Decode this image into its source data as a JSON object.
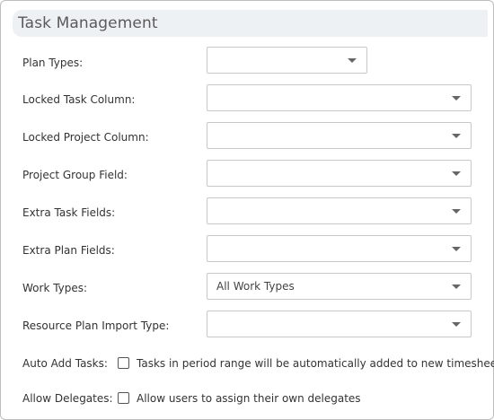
{
  "section": {
    "title": "Task Management"
  },
  "fields": {
    "plan_types": {
      "label": "Plan Types:",
      "value": ""
    },
    "locked_task_column": {
      "label": "Locked Task Column:",
      "value": ""
    },
    "locked_project_column": {
      "label": "Locked Project Column:",
      "value": ""
    },
    "project_group_field": {
      "label": "Project Group Field:",
      "value": ""
    },
    "extra_task_fields": {
      "label": "Extra Task Fields:",
      "value": ""
    },
    "extra_plan_fields": {
      "label": "Extra Plan Fields:",
      "value": ""
    },
    "work_types": {
      "label": "Work Types:",
      "value": "All Work Types"
    },
    "resource_plan_import_type": {
      "label": "Resource Plan Import Type:",
      "value": ""
    }
  },
  "checkboxes": {
    "auto_add_tasks": {
      "label": "Auto Add Tasks:",
      "text": "Tasks in period range will be automatically added to new timesheets",
      "checked": false
    },
    "allow_delegates": {
      "label": "Allow Delegates:",
      "text": "Allow users to assign their own delegates",
      "checked": false
    }
  },
  "icons": {
    "dropdown": "chevron-down-icon"
  }
}
